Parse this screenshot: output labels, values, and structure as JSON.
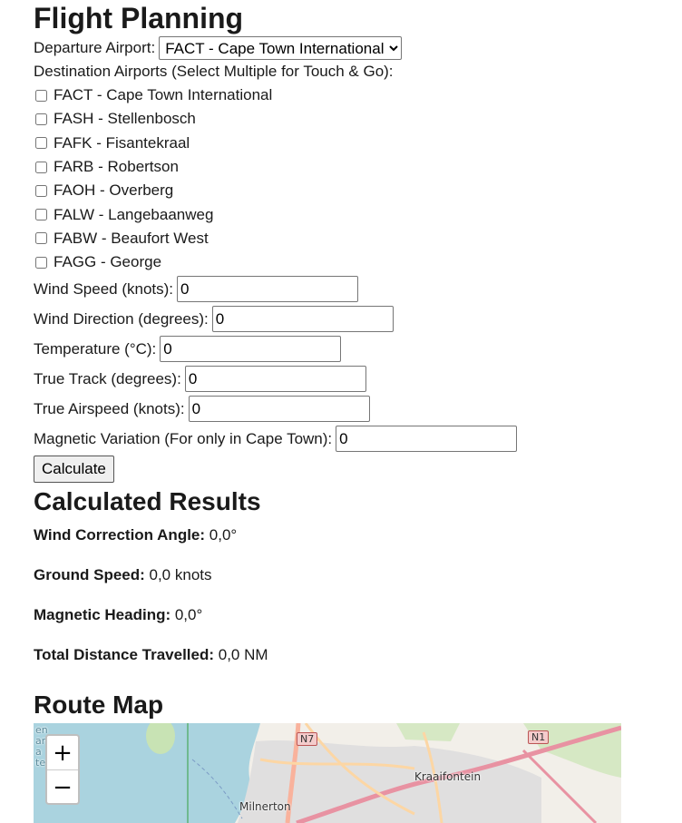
{
  "title": "Flight Planning",
  "departure": {
    "label": "Departure Airport:",
    "selected": "FACT - Cape Town International"
  },
  "destinations": {
    "label": "Destination Airports (Select Multiple for Touch & Go):",
    "items": [
      {
        "label": "FACT - Cape Town International",
        "checked": false
      },
      {
        "label": "FASH - Stellenbosch",
        "checked": false
      },
      {
        "label": "FAFK - Fisantekraal",
        "checked": false
      },
      {
        "label": "FARB - Robertson",
        "checked": false
      },
      {
        "label": "FAOH - Overberg",
        "checked": false
      },
      {
        "label": "FALW - Langebaanweg",
        "checked": false
      },
      {
        "label": "FABW - Beaufort West",
        "checked": false
      },
      {
        "label": "FAGG - George",
        "checked": false
      }
    ]
  },
  "fields": {
    "wind_speed": {
      "label": "Wind Speed (knots):",
      "value": "0"
    },
    "wind_direction": {
      "label": "Wind Direction (degrees):",
      "value": "0"
    },
    "temperature": {
      "label": "Temperature (°C):",
      "value": "0"
    },
    "true_track": {
      "label": "True Track (degrees):",
      "value": "0"
    },
    "true_airspeed": {
      "label": "True Airspeed (knots):",
      "value": "0"
    },
    "magnetic_variation": {
      "label": "Magnetic Variation (For only in Cape Town):",
      "value": "0"
    }
  },
  "calculate_label": "Calculate",
  "results": {
    "heading": "Calculated Results",
    "wca_label": "Wind Correction Angle:",
    "wca_value": " 0,0°",
    "gs_label": "Ground Speed:",
    "gs_value": " 0,0 knots",
    "mh_label": "Magnetic Heading:",
    "mh_value": " 0,0°",
    "dist_label": "Total Distance Travelled:",
    "dist_value": " 0,0 NM"
  },
  "map": {
    "heading": "Route Map",
    "zoom_in": "+",
    "zoom_out": "−",
    "labels": {
      "kraaifontein": "Kraaifontein",
      "milnerton": "Milnerton",
      "n7": "N7",
      "n1": "N1",
      "edge_text": "en ar a te"
    },
    "colors": {
      "sea": "#aad3df",
      "land": "#f2efe9",
      "urban": "#e0dfdf",
      "motorway": "#e892a2",
      "primary": "#fcd6a4",
      "green": "#c8e3b4"
    }
  }
}
